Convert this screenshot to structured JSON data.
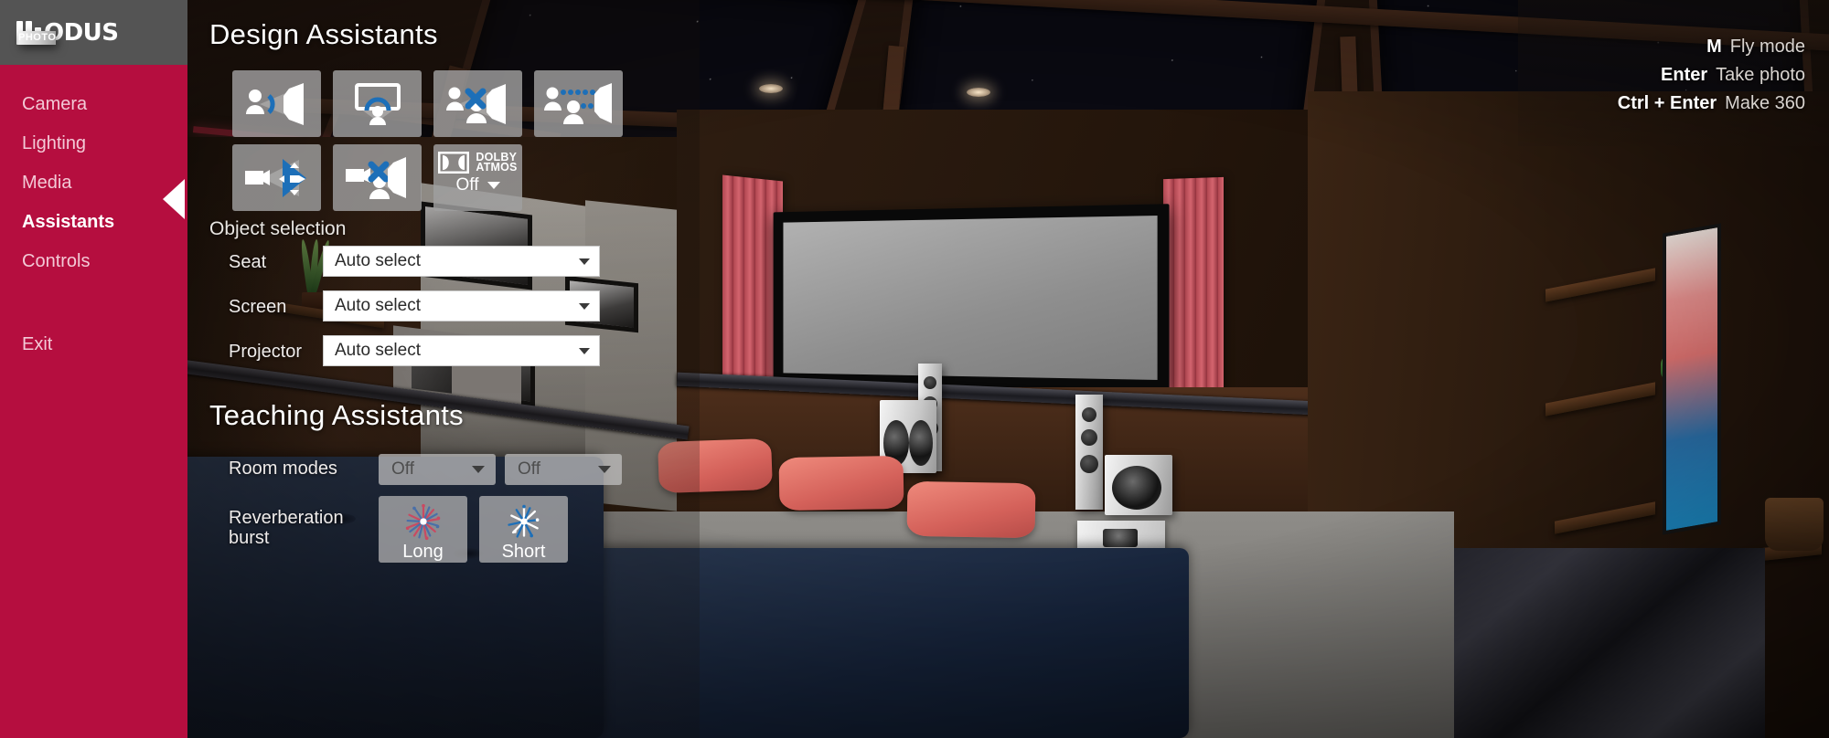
{
  "brand": {
    "word": "ODUS",
    "suffix": "PHOTO"
  },
  "sidebar": {
    "items": [
      {
        "label": "Camera",
        "active": false
      },
      {
        "label": "Lighting",
        "active": false
      },
      {
        "label": "Media",
        "active": false
      },
      {
        "label": "Assistants",
        "active": true
      },
      {
        "label": "Controls",
        "active": false
      }
    ],
    "exit": "Exit"
  },
  "panel": {
    "design_title": "Design Assistants",
    "teaching_title": "Teaching Assistants",
    "object_selection_label": "Object selection",
    "assistant_buttons": [
      {
        "name": "listener-to-speaker-angle",
        "tooltip": "Listener to speaker angle"
      },
      {
        "name": "screen-viewing-angle",
        "tooltip": "Screen viewing angle"
      },
      {
        "name": "speaker-obstruction",
        "tooltip": "Speaker obstruction"
      },
      {
        "name": "speaker-distance",
        "tooltip": "Speaker distance"
      },
      {
        "name": "projector-throw",
        "tooltip": "Projector throw"
      },
      {
        "name": "projector-obstruction",
        "tooltip": "Projector obstruction"
      }
    ],
    "atmos": {
      "brand": "DOLBY",
      "brand2": "ATMOS",
      "value": "Off"
    },
    "fields": [
      {
        "label": "Seat",
        "value": "Auto select"
      },
      {
        "label": "Screen",
        "value": "Auto select"
      },
      {
        "label": "Projector",
        "value": "Auto select"
      }
    ],
    "room_modes": {
      "label": "Room modes",
      "value_a": "Off",
      "value_b": "Off"
    },
    "reverberation": {
      "label_line1": "Reverberation",
      "label_line2": "burst",
      "long": "Long",
      "short": "Short"
    }
  },
  "shortcuts": [
    {
      "key": "M",
      "action": "Fly mode"
    },
    {
      "key": "Enter",
      "action": "Take photo"
    },
    {
      "key": "Ctrl + Enter",
      "action": "Make 360"
    }
  ],
  "colors": {
    "brand_magenta": "#b50e3f",
    "logo_bar": "#545454",
    "accent_blue": "#1d6fb8"
  }
}
